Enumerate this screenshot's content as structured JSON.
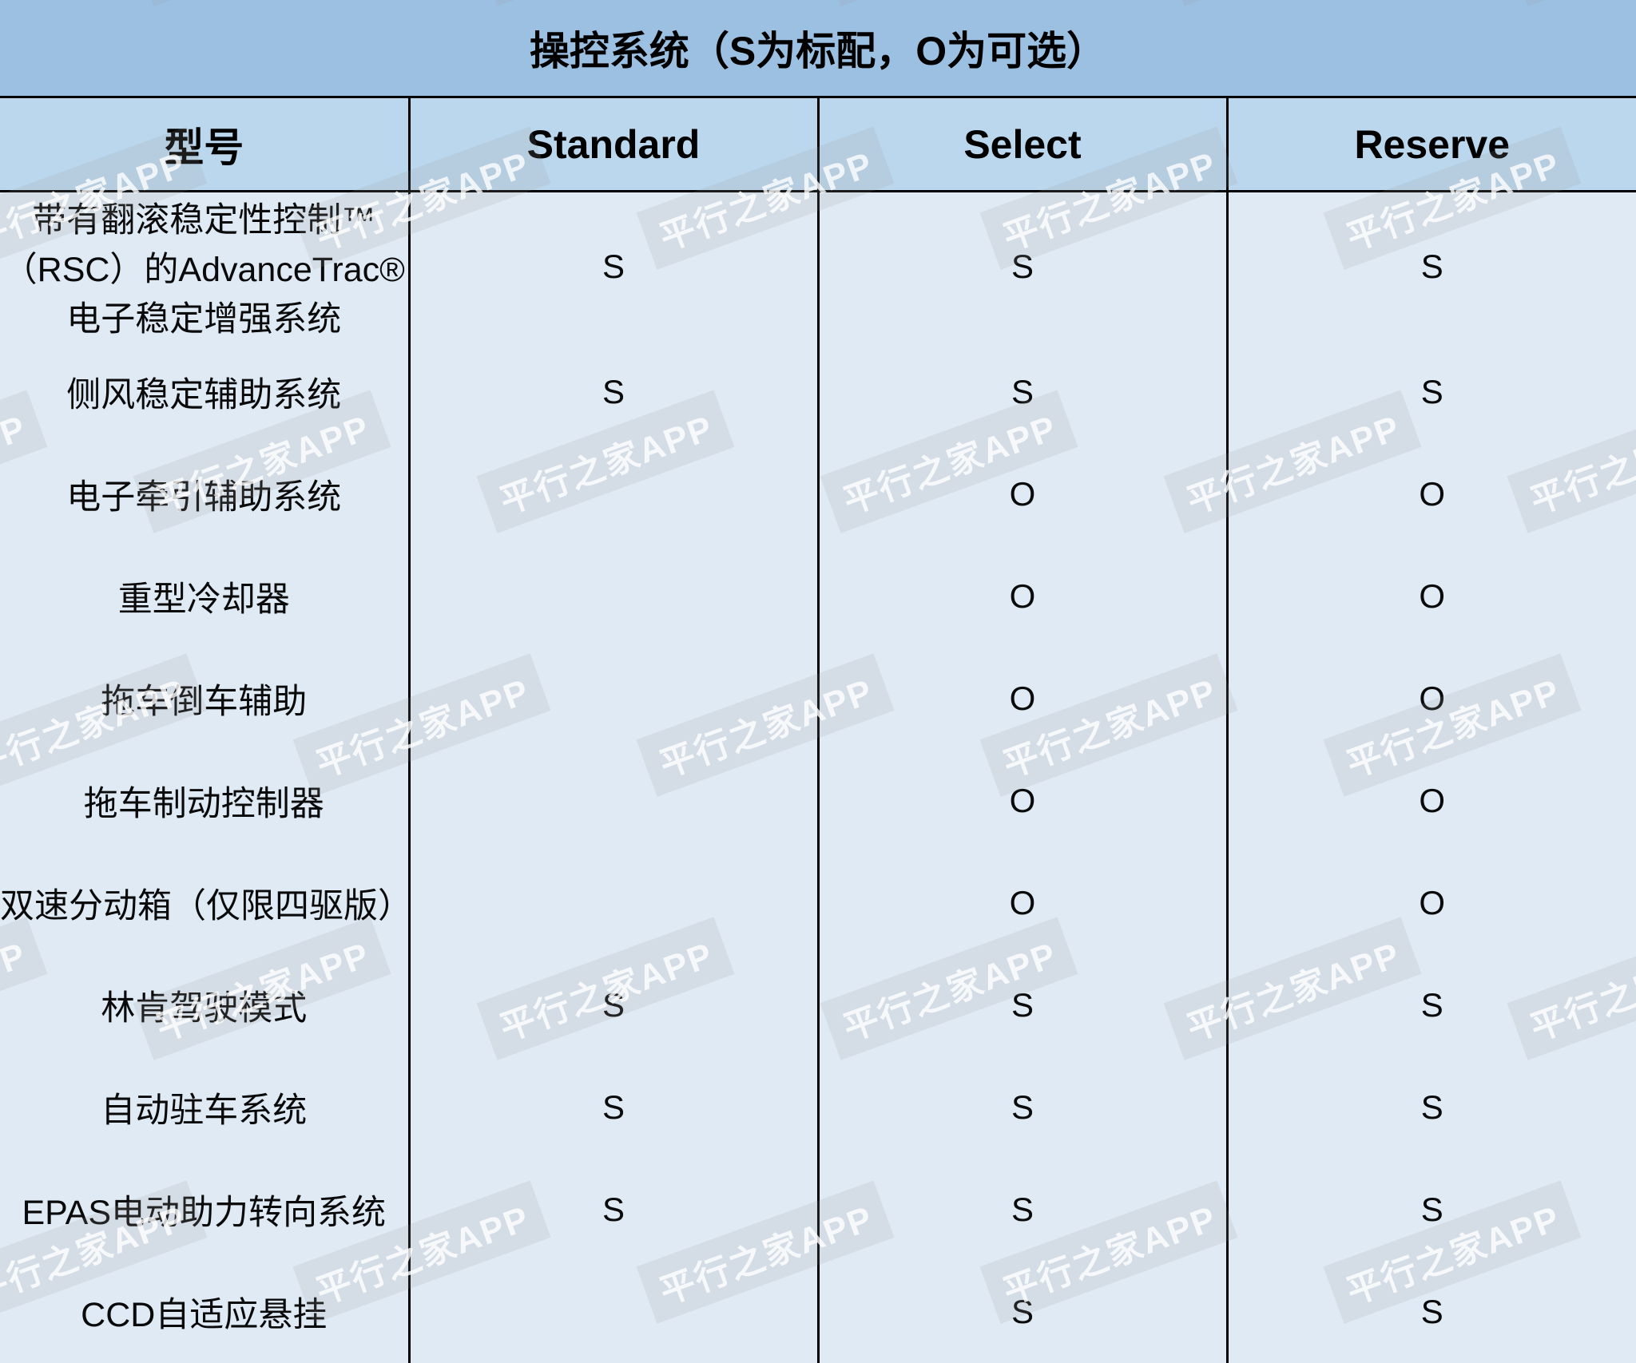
{
  "table": {
    "title": "操控系统（S为标配，O为可选）",
    "columns": [
      {
        "key": "name",
        "label": "型号"
      },
      {
        "key": "standard",
        "label": "Standard"
      },
      {
        "key": "select",
        "label": "Select"
      },
      {
        "key": "reserve",
        "label": "Reserve"
      }
    ],
    "rows": [
      {
        "name": "带有翻滚稳定性控制™（RSC）的AdvanceTrac® 电子稳定增强系统",
        "standard": "S",
        "select": "S",
        "reserve": "S"
      },
      {
        "name": "侧风稳定辅助系统",
        "standard": "S",
        "select": "S",
        "reserve": "S"
      },
      {
        "name": "电子牵引辅助系统",
        "standard": "",
        "select": "O",
        "reserve": "O"
      },
      {
        "name": "重型冷却器",
        "standard": "",
        "select": "O",
        "reserve": "O"
      },
      {
        "name": "拖车倒车辅助",
        "standard": "",
        "select": "O",
        "reserve": "O"
      },
      {
        "name": "拖车制动控制器",
        "standard": "",
        "select": "O",
        "reserve": "O"
      },
      {
        "name": "双速分动箱（仅限四驱版）",
        "standard": "",
        "select": "O",
        "reserve": "O"
      },
      {
        "name": "林肯驾驶模式",
        "standard": "S",
        "select": "S",
        "reserve": "S"
      },
      {
        "name": "自动驻车系统",
        "standard": "S",
        "select": "S",
        "reserve": "S"
      },
      {
        "name": "EPAS电动助力转向系统",
        "standard": "S",
        "select": "S",
        "reserve": "S"
      },
      {
        "name": "CCD自适应悬挂",
        "standard": "",
        "select": "S",
        "reserve": "S"
      }
    ],
    "legend": {
      "standard_mark": "S",
      "optional_mark": "O"
    },
    "colors": {
      "title_bg": "#9CC0E2",
      "header_bg": "#BBD7ED",
      "row_bg": "#DFEAF5",
      "border": "#000000",
      "text": "#000000"
    }
  },
  "watermark": {
    "text": "平行之家APP"
  }
}
